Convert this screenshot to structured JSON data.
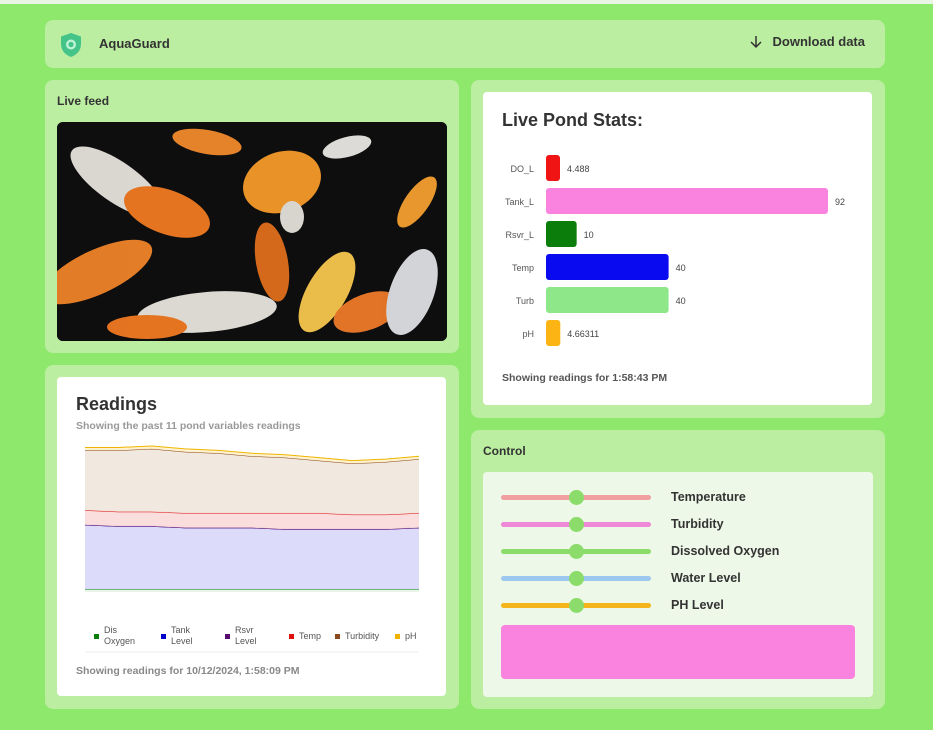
{
  "header": {
    "app_name": "AquaGuard",
    "download_label": "Download data",
    "brand_color": "#45c48a"
  },
  "live_feed": {
    "title": "Live feed"
  },
  "readings": {
    "title": "Readings",
    "subtitle": "Showing the past 11 pond variables readings",
    "footer": "Showing readings for 10/12/2024, 1:58:09 PM",
    "legend": [
      {
        "label": "Dis Oxygen",
        "line1": "Dis",
        "line2": "Oxygen",
        "color": "#0a7d0a"
      },
      {
        "label": "Tank Level",
        "line1": "Tank",
        "line2": "Level",
        "color": "#0000cc"
      },
      {
        "label": "Rsvr Level",
        "line1": "Rsvr",
        "line2": "Level",
        "color": "#5a0a6e"
      },
      {
        "label": "Temp",
        "line1": "Temp",
        "line2": "",
        "color": "#e01010"
      },
      {
        "label": "Turbidity",
        "line1": "Turbidity",
        "line2": "",
        "color": "#8b4a1c"
      },
      {
        "label": "pH",
        "line1": "pH",
        "line2": "",
        "color": "#f0b400"
      }
    ]
  },
  "stats": {
    "title": "Live Pond Stats:",
    "footer": "Showing readings for 1:58:43 PM"
  },
  "chart_data": [
    {
      "type": "bar",
      "title": "Live Pond Stats:",
      "orientation": "horizontal",
      "categories": [
        "DO_L",
        "Tank_L",
        "Rsvr_L",
        "Temp",
        "Turb",
        "pH"
      ],
      "values": [
        4.488,
        92,
        10,
        40,
        40,
        4.66311
      ],
      "value_labels": [
        "4.488",
        "92",
        "10",
        "40",
        "40",
        "4.66311"
      ],
      "colors": [
        "#f01414",
        "#fb83e0",
        "#0a7d0a",
        "#0a0af0",
        "#8ee88a",
        "#fbb414"
      ],
      "xlim": [
        0,
        92
      ],
      "grid": false
    },
    {
      "type": "area",
      "title": "Readings",
      "x": [
        1,
        2,
        3,
        4,
        5,
        6,
        7,
        8,
        9,
        10,
        11
      ],
      "series": [
        {
          "name": "Dis Oxygen",
          "color": "#0a7d0a",
          "values": [
            2,
            2,
            2,
            2,
            2,
            2,
            2,
            2,
            2,
            2,
            2
          ]
        },
        {
          "name": "Tank Level",
          "color": "#0000cc",
          "values": [
            44,
            43,
            43,
            42,
            42,
            42,
            41,
            41,
            41,
            41,
            42
          ]
        },
        {
          "name": "Rsvr Level",
          "color": "#5a0a6e",
          "values": [
            0,
            0,
            0,
            0,
            0,
            0,
            0,
            0,
            0,
            0,
            0
          ]
        },
        {
          "name": "Temp",
          "color": "#e01010",
          "values": [
            10,
            10,
            10,
            10,
            10,
            10,
            11,
            11,
            10,
            10,
            10
          ]
        },
        {
          "name": "Turbidity",
          "color": "#8b4a1c",
          "values": [
            41,
            42,
            43,
            42,
            41,
            39,
            38,
            36,
            35,
            36,
            37
          ]
        },
        {
          "name": "pH",
          "color": "#f0b400",
          "values": [
            2,
            2,
            2,
            2,
            2,
            2,
            2,
            2,
            2,
            2,
            2
          ]
        }
      ],
      "stacked": true,
      "ylim": [
        0,
        100
      ],
      "legend_position": "bottom",
      "grid": false
    }
  ],
  "control": {
    "title": "Control",
    "sliders": [
      {
        "label": "Temperature",
        "value": 0.5,
        "color": "#f0a0a0"
      },
      {
        "label": "Turbidity",
        "value": 0.5,
        "color": "#f088d8"
      },
      {
        "label": "Dissolved Oxygen",
        "value": 0.5,
        "color": "#8bdc6a"
      },
      {
        "label": "Water Level",
        "value": 0.5,
        "color": "#9cc8f0"
      },
      {
        "label": "PH Level",
        "value": 0.5,
        "color": "#f4b41a"
      }
    ],
    "output_color": "#fb83e0"
  }
}
